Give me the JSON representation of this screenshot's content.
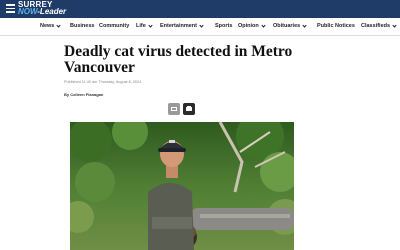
{
  "site": {
    "logo_top": "SURREY",
    "logo_now": "NOW",
    "logo_leader": "-Leader"
  },
  "nav": [
    {
      "label": "News",
      "has_dropdown": true
    },
    {
      "label": "Business",
      "has_dropdown": false
    },
    {
      "label": "Community",
      "has_dropdown": false
    },
    {
      "label": "Life",
      "has_dropdown": true
    },
    {
      "label": "Entertainment",
      "has_dropdown": true
    },
    {
      "label": "Sports",
      "has_dropdown": false
    },
    {
      "label": "Opinion",
      "has_dropdown": true
    },
    {
      "label": "Obituaries",
      "has_dropdown": true
    },
    {
      "label": "Public Notices",
      "has_dropdown": false
    },
    {
      "label": "Classifieds",
      "has_dropdown": true
    }
  ],
  "article": {
    "title": "Deadly cat virus detected in Metro Vancouver",
    "published": "Published 11:40 am Thursday, August 8, 2024",
    "byline": "By Colleen Flanagan"
  },
  "share": {
    "email_icon": "envelope-icon",
    "print_icon": "printer-icon"
  },
  "colors": {
    "header_bg": "#1f3c68",
    "logo_accent": "#5fb3e6",
    "email_button": "#9a9a9a",
    "print_button": "#2b2b2b"
  }
}
